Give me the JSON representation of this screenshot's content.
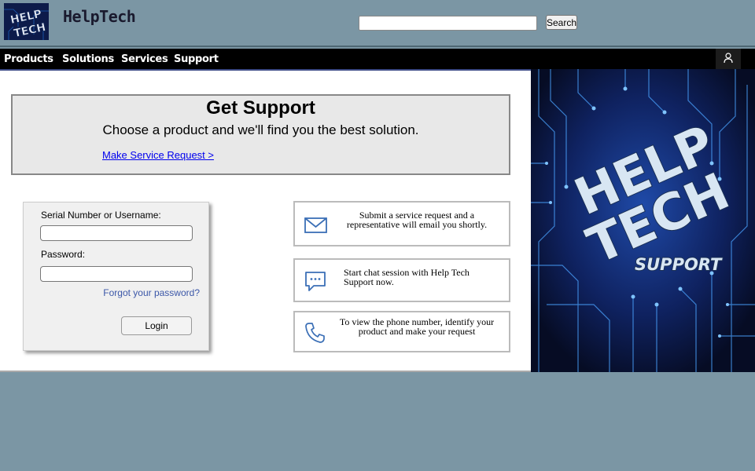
{
  "header": {
    "brand": "HelpTech",
    "logo_text": [
      "HELP",
      "TECH"
    ],
    "search_placeholder": "",
    "search_button": "Search"
  },
  "nav": {
    "items": [
      "Products",
      "Solutions",
      "Services",
      "Support"
    ],
    "user_icon": "user-icon"
  },
  "banner": {
    "title": "Get Support",
    "subtitle": "Choose a product and we'll find you the best solution.",
    "link": "Make Service Request >"
  },
  "login": {
    "username_label": "Serial Number or Username:",
    "password_label": "Password:",
    "forgot": "Forgot your password?",
    "button": "Login"
  },
  "options": [
    {
      "icon": "email-icon",
      "text": "Submit a service request and a representative will email you shortly."
    },
    {
      "icon": "chat-icon",
      "text": "Start chat session with Help Tech Support now."
    },
    {
      "icon": "phone-icon",
      "text": "To view the phone number, identify your product and make your request"
    }
  ],
  "hero": {
    "line1": "HELP",
    "line2": "TECH",
    "line3": "SUPPORT"
  },
  "colors": {
    "header_bg": "#7b96a4",
    "nav_bg": "#000000",
    "link": "#0000ee",
    "icon_blue": "#3b6fb6",
    "hero_bg": "#0c1538"
  }
}
